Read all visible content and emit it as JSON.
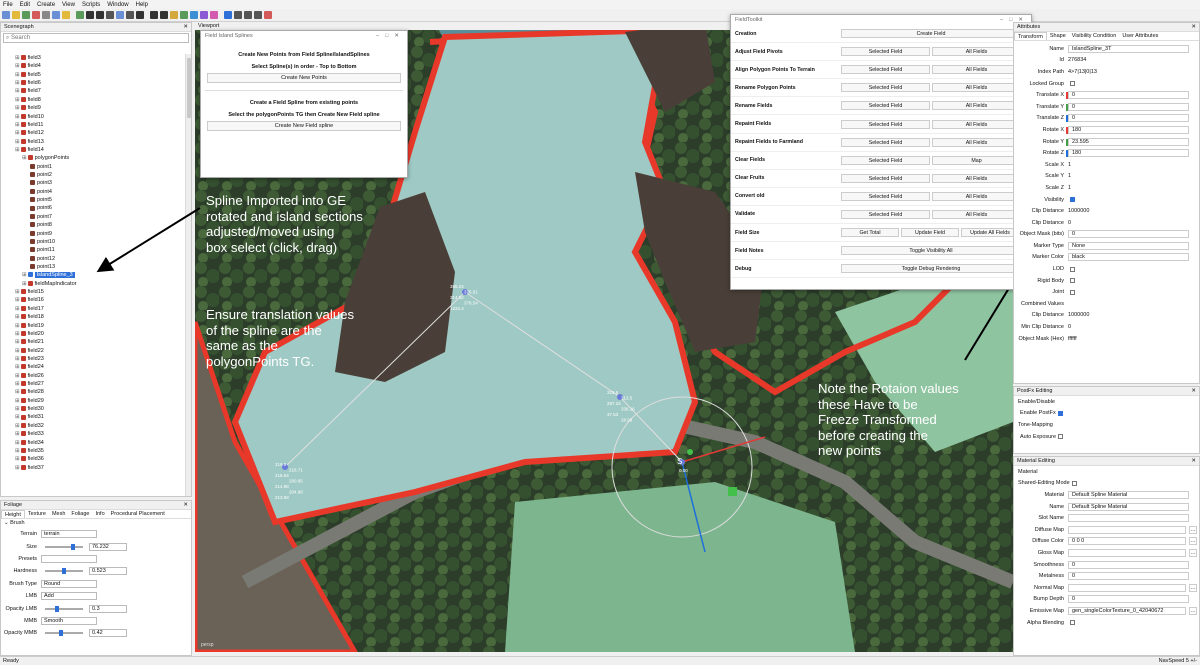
{
  "menu": [
    "File",
    "Edit",
    "Create",
    "View",
    "Scripts",
    "Window",
    "Help"
  ],
  "scenegraph": {
    "title": "Scenegraph",
    "search_placeholder": "Search",
    "rows": [
      {
        "label": "field3",
        "indent": 2,
        "type": "field"
      },
      {
        "label": "field4",
        "indent": 2,
        "type": "field"
      },
      {
        "label": "field5",
        "indent": 2,
        "type": "field"
      },
      {
        "label": "field6",
        "indent": 2,
        "type": "field"
      },
      {
        "label": "field7",
        "indent": 2,
        "type": "field"
      },
      {
        "label": "field8",
        "indent": 2,
        "type": "field"
      },
      {
        "label": "field9",
        "indent": 2,
        "type": "field"
      },
      {
        "label": "field10",
        "indent": 2,
        "type": "field"
      },
      {
        "label": "field11",
        "indent": 2,
        "type": "field"
      },
      {
        "label": "field12",
        "indent": 2,
        "type": "field"
      },
      {
        "label": "field13",
        "indent": 2,
        "type": "field"
      },
      {
        "label": "field14",
        "indent": 2,
        "type": "field"
      },
      {
        "label": "polygonPoints",
        "indent": 3,
        "type": "field"
      },
      {
        "label": "point1",
        "indent": 4,
        "type": "point"
      },
      {
        "label": "point2",
        "indent": 4,
        "type": "point"
      },
      {
        "label": "point3",
        "indent": 4,
        "type": "point"
      },
      {
        "label": "point4",
        "indent": 4,
        "type": "point"
      },
      {
        "label": "point5",
        "indent": 4,
        "type": "point"
      },
      {
        "label": "point6",
        "indent": 4,
        "type": "point"
      },
      {
        "label": "point7",
        "indent": 4,
        "type": "point"
      },
      {
        "label": "point8",
        "indent": 4,
        "type": "point"
      },
      {
        "label": "point9",
        "indent": 4,
        "type": "point"
      },
      {
        "label": "point10",
        "indent": 4,
        "type": "point"
      },
      {
        "label": "point11",
        "indent": 4,
        "type": "point"
      },
      {
        "label": "point12",
        "indent": 4,
        "type": "point"
      },
      {
        "label": "point13",
        "indent": 4,
        "type": "point"
      },
      {
        "label": "IslandSpline_3",
        "indent": 3,
        "type": "spline",
        "selected": true
      },
      {
        "label": "fieldMapIndicator",
        "indent": 3,
        "type": "field"
      },
      {
        "label": "field15",
        "indent": 2,
        "type": "field"
      },
      {
        "label": "field16",
        "indent": 2,
        "type": "field"
      },
      {
        "label": "field17",
        "indent": 2,
        "type": "field"
      },
      {
        "label": "field18",
        "indent": 2,
        "type": "field"
      },
      {
        "label": "field19",
        "indent": 2,
        "type": "field"
      },
      {
        "label": "field20",
        "indent": 2,
        "type": "field"
      },
      {
        "label": "field21",
        "indent": 2,
        "type": "field"
      },
      {
        "label": "field22",
        "indent": 2,
        "type": "field"
      },
      {
        "label": "field23",
        "indent": 2,
        "type": "field"
      },
      {
        "label": "field24",
        "indent": 2,
        "type": "field"
      },
      {
        "label": "field26",
        "indent": 2,
        "type": "field"
      },
      {
        "label": "field27",
        "indent": 2,
        "type": "field"
      },
      {
        "label": "field28",
        "indent": 2,
        "type": "field"
      },
      {
        "label": "field29",
        "indent": 2,
        "type": "field"
      },
      {
        "label": "field30",
        "indent": 2,
        "type": "field"
      },
      {
        "label": "field31",
        "indent": 2,
        "type": "field"
      },
      {
        "label": "field32",
        "indent": 2,
        "type": "field"
      },
      {
        "label": "field33",
        "indent": 2,
        "type": "field"
      },
      {
        "label": "field34",
        "indent": 2,
        "type": "field"
      },
      {
        "label": "field35",
        "indent": 2,
        "type": "field"
      },
      {
        "label": "field36",
        "indent": 2,
        "type": "field"
      },
      {
        "label": "field37",
        "indent": 2,
        "type": "field"
      }
    ]
  },
  "foliage": {
    "title": "Foliage",
    "tabs": [
      "Height",
      "Texture",
      "Mesh",
      "Foliage",
      "Info",
      "Procedural Placement"
    ],
    "section": "Brush",
    "fields": [
      {
        "label": "Terrain",
        "value": "terrain",
        "kind": "select"
      },
      {
        "label": "Size",
        "value": "76.232",
        "kind": "slider",
        "pos": 0.75
      },
      {
        "label": "Presets",
        "value": "",
        "kind": "select"
      },
      {
        "label": "Hardness",
        "value": "0.523",
        "kind": "slider",
        "pos": 0.5
      },
      {
        "label": "Brush Type",
        "value": "Round",
        "kind": "select"
      },
      {
        "label": "LMB",
        "value": "Add",
        "kind": "select"
      },
      {
        "label": "Opacity LMB",
        "value": "0.3",
        "kind": "slider",
        "pos": 0.3
      },
      {
        "label": "MMB",
        "value": "Smooth",
        "kind": "select"
      },
      {
        "label": "Opacity MMB",
        "value": "0.42",
        "kind": "slider",
        "pos": 0.42
      }
    ]
  },
  "viewport": {
    "title": "Viewport",
    "footer": "persp"
  },
  "field_island": {
    "title": "Field Island Splines",
    "line1": "Create New Points from Field Spline/IslandSplines",
    "line2": "Select Spline(s) in order - Top to Bottom",
    "button1": "Create New Points",
    "line3": "Create a Field Spline from existing points",
    "line4": "Select the polygonPoints TG then Create New Field spline",
    "button2": "Create New Field spline"
  },
  "field_toolkit": {
    "title": "FieldToolkit",
    "rows": [
      {
        "name": "Creation",
        "buttons": [
          "Create Field"
        ]
      },
      {
        "name": "Adjust Field Pivots",
        "buttons": [
          "Selected Field",
          "All Fields"
        ]
      },
      {
        "name": "Align Polygon Points To Terrain",
        "buttons": [
          "Selected Field",
          "All Fields"
        ]
      },
      {
        "name": "Rename Polygon Points",
        "buttons": [
          "Selected Field",
          "All Fields"
        ]
      },
      {
        "name": "Rename Fields",
        "buttons": [
          "Selected Field",
          "All Fields"
        ]
      },
      {
        "name": "Repaint Fields",
        "buttons": [
          "Selected Field",
          "All Fields"
        ]
      },
      {
        "name": "Repaint Fields to Farmland",
        "buttons": [
          "Selected Field",
          "All Fields"
        ]
      },
      {
        "name": "Clear Fields",
        "buttons": [
          "Selected Field",
          "Map"
        ]
      },
      {
        "name": "Clear Fruits",
        "buttons": [
          "Selected Field",
          "All Fields"
        ]
      },
      {
        "name": "Convert old",
        "buttons": [
          "Selected Field",
          "All Fields"
        ]
      },
      {
        "name": "Validate",
        "buttons": [
          "Selected Field",
          "All Fields"
        ]
      },
      {
        "name": "Field Size",
        "buttons": [
          "Get Total",
          "Update Field",
          "Update All Fields"
        ]
      },
      {
        "name": "Field Notes",
        "buttons": [
          "Toggle Visibility All"
        ]
      },
      {
        "name": "Debug",
        "buttons": [
          "Toggle Debug Rendering"
        ]
      }
    ]
  },
  "annotations": {
    "a1": [
      "Spline Imported into GE",
      "rotated and island sections",
      "adjusted/moved using",
      "box select (click, drag)"
    ],
    "a2": [
      "Ensure translation values",
      "of the spline are the",
      "same as the",
      "polygonPoints TG."
    ],
    "a3": [
      "Note the Rotaion values",
      "these Have to be",
      "Freeze Transformed",
      "before creating the",
      "new points"
    ]
  },
  "attributes": {
    "title": "Attributes",
    "tabs": [
      "Transform",
      "Shape",
      "Visibility Condition",
      "User Attributes"
    ],
    "rows": [
      {
        "label": "Name",
        "value": "IslandSpline_3T"
      },
      {
        "label": "Id",
        "value": "276834",
        "plain": true
      },
      {
        "label": "Index Path",
        "value": "4>7|13|0|13",
        "plain": true
      },
      {
        "label": "Locked Group",
        "value": "",
        "check": true
      },
      {
        "label": "Translate X",
        "value": "0",
        "axis": "r"
      },
      {
        "label": "Translate Y",
        "value": "0",
        "axis": "g"
      },
      {
        "label": "Translate Z",
        "value": "0",
        "axis": "bl"
      },
      {
        "label": "Rotate X",
        "value": "180",
        "axis": "r"
      },
      {
        "label": "Rotate Y",
        "value": "23.595",
        "axis": "g"
      },
      {
        "label": "Rotate Z",
        "value": "180",
        "axis": "bl"
      },
      {
        "label": "Scale X",
        "value": "1",
        "plain": true
      },
      {
        "label": "Scale Y",
        "value": "1",
        "plain": true
      },
      {
        "label": "Scale Z",
        "value": "1",
        "plain": true
      },
      {
        "label": "Visibility",
        "value": "",
        "check": true,
        "on": true
      },
      {
        "label": "Clip Distance",
        "value": "1000000",
        "plain": true
      },
      {
        "label": "Clip Distance",
        "value": "0",
        "plain": true
      },
      {
        "label": "Object Mask (bits)",
        "value": "0"
      },
      {
        "label": "Marker Type",
        "value": "None"
      },
      {
        "label": "Marker Color",
        "value": "black"
      },
      {
        "label": "LOD",
        "value": "",
        "check": true
      },
      {
        "label": "Rigid Body",
        "value": "",
        "check": true
      },
      {
        "label": "Joint",
        "value": "",
        "check": true
      },
      {
        "label": "Combined Values",
        "value": "",
        "plain": true
      },
      {
        "label": "Clip Distance",
        "value": "1000000",
        "plain": true
      },
      {
        "label": "Min Clip Distance",
        "value": "0",
        "plain": true
      },
      {
        "label": "Object Mask (Hex)",
        "value": "ffffff",
        "plain": true
      }
    ]
  },
  "postfx": {
    "title": "PostFx Editing",
    "enable_section": "Enable/Disable",
    "enable_label": "Enable PostFx",
    "tone_section": "Tone-Mapping",
    "auto_exposure": "Auto Exposure"
  },
  "material": {
    "title": "Material Editing",
    "section": "Material",
    "shared": "Shared-Editing Mode",
    "rows": [
      {
        "label": "Material",
        "value": "Default Spline Material"
      },
      {
        "label": "Name",
        "value": "Default Spline Material"
      },
      {
        "label": "Slot Name",
        "value": ""
      },
      {
        "label": "Diffuse Map",
        "value": "",
        "btn": true
      },
      {
        "label": "Diffuse Color",
        "value": "0     0     0",
        "btn": true
      },
      {
        "label": "Gloss Map",
        "value": "",
        "btn": true
      },
      {
        "label": "Smoothness",
        "value": "0"
      },
      {
        "label": "Metalness",
        "value": "0"
      },
      {
        "label": "Normal Map",
        "value": "",
        "btn": true
      },
      {
        "label": "Bump Depth",
        "value": "0"
      },
      {
        "label": "Emissive Map",
        "value": "gen_singleColorTexture_0_42040672",
        "btn": true
      },
      {
        "label": "Alpha Blending",
        "value": "",
        "check": true
      }
    ]
  },
  "status": {
    "left": "Ready",
    "right": "NavSpeed 5 +/-"
  },
  "labels": {
    "p1": [
      "219.9",
      "218.71",
      "216.54",
      "260.85",
      "214.98",
      "204.98",
      "213.58"
    ],
    "p2": [
      "385.24",
      "376.51",
      "314.52",
      "378.54",
      "1232.4"
    ],
    "p3": [
      "315.6",
      "313.5",
      "287.24",
      "336.16",
      "37.53",
      "28.96"
    ],
    "gizmo_label": "S",
    "gizmo_value": "0.00"
  },
  "colors": {
    "field_outline": "#e8382a",
    "water": "#9fc9c4",
    "island": "#4a3f38",
    "grass": "#7cb58e"
  }
}
